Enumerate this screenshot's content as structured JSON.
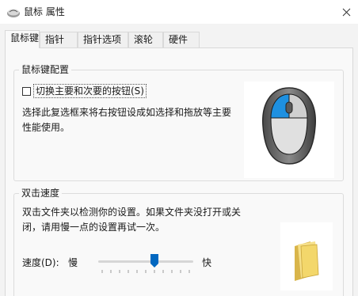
{
  "window": {
    "title": "鼠标 属性",
    "icon": "mouse-icon"
  },
  "tabs": [
    {
      "label": "鼠标键",
      "active": true
    },
    {
      "label": "指针",
      "active": false
    },
    {
      "label": "指针选项",
      "active": false
    },
    {
      "label": "滚轮",
      "active": false
    },
    {
      "label": "硬件",
      "active": false
    }
  ],
  "button_config": {
    "heading": "鼠标键配置",
    "checkbox_label": "切换主要和次要的按钮(S)",
    "checked": false,
    "description_line1": "选择此复选框来将右按钮设成如选择和拖放等主要",
    "description_line2": "性能使用。",
    "illustration_icon": "mouse-illustration-icon",
    "primary_color": "#1e90e0"
  },
  "double_click": {
    "heading": "双击速度",
    "description_line1": "双击文件夹以检测你的设置。如果文件夹没打开或关",
    "description_line2": "闭，请用慢一点的设置再试一次。",
    "speed_label": "速度(D):",
    "slow_label": "慢",
    "fast_label": "快",
    "speed_fraction": 0.6,
    "test_folder_icon": "folder-icon"
  },
  "colors": {
    "accent": "#0067c0"
  }
}
